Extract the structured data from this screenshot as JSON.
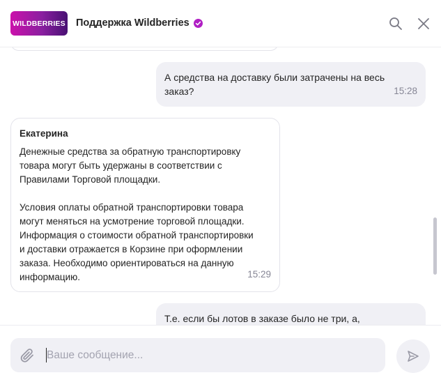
{
  "header": {
    "logo_text": "WILDBERRIES",
    "title": "Поддержка Wildberries",
    "icons": {
      "verified": "verified-check-icon",
      "search": "search-icon",
      "close": "close-icon"
    },
    "colors": {
      "brand_start": "#cb11ab",
      "brand_end": "#481173",
      "verified": "#b01fc4"
    }
  },
  "messages": [
    {
      "direction": "outgoing",
      "text": "А средства на доставку были затрачены на весь заказ?",
      "time": "15:28"
    },
    {
      "direction": "incoming",
      "sender": "Екатерина",
      "text": "Денежные средства за обратную транспортировку товара могут быть удержаны в соответствии с Правилами Торговой площадки.\n\nУсловия оплаты обратной транспортировки товара могут меняться на усмотрение торговой площадки. Информация о стоимости обратной транспортировки и доставки отражается в Корзине при оформлении заказа. Необходимо ориентироваться на данную информацию.",
      "time": "15:29"
    },
    {
      "direction": "outgoing",
      "text": "Т.е. если бы лотов в заказе было не три, а,"
    }
  ],
  "composer": {
    "placeholder": "Ваше сообщение...",
    "value": "",
    "icons": {
      "attach": "paperclip-icon",
      "send": "send-icon"
    }
  }
}
